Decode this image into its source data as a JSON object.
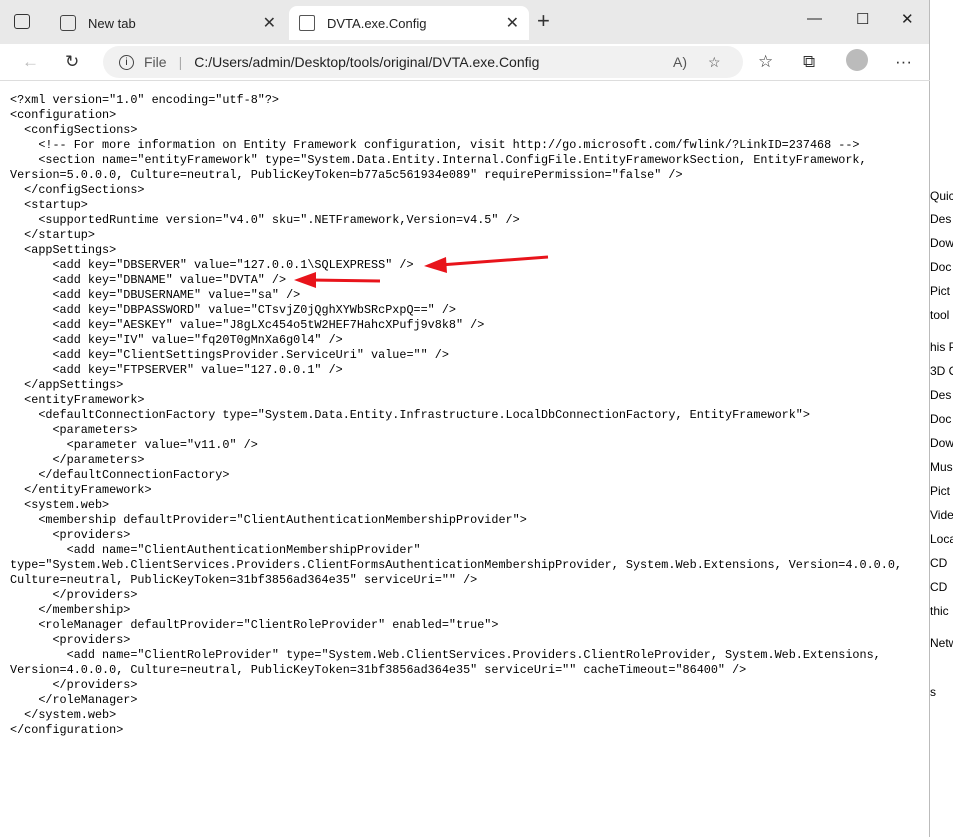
{
  "browser": {
    "tabs": [
      {
        "label": "New tab"
      },
      {
        "label": "DVTA.exe.Config"
      }
    ],
    "address": {
      "scheme": "File",
      "url": "C:/Users/admin/Desktop/tools/original/DVTA.exe.Config"
    }
  },
  "document": {
    "lines": [
      "<?xml version=\"1.0\" encoding=\"utf-8\"?>",
      "<configuration>",
      "  <configSections>",
      "    <!-- For more information on Entity Framework configuration, visit http://go.microsoft.com/fwlink/?LinkID=237468 -->",
      "    <section name=\"entityFramework\" type=\"System.Data.Entity.Internal.ConfigFile.EntityFrameworkSection, EntityFramework,",
      "Version=5.0.0.0, Culture=neutral, PublicKeyToken=b77a5c561934e089\" requirePermission=\"false\" />",
      "  </configSections>",
      "  <startup>",
      "    <supportedRuntime version=\"v4.0\" sku=\".NETFramework,Version=v4.5\" />",
      "  </startup>",
      "  <appSettings>",
      "      <add key=\"DBSERVER\" value=\"127.0.0.1\\SQLEXPRESS\" />",
      "      <add key=\"DBNAME\" value=\"DVTA\" />",
      "      <add key=\"DBUSERNAME\" value=\"sa\" />",
      "      <add key=\"DBPASSWORD\" value=\"CTsvjZ0jQghXYWbSRcPxpQ==\" />",
      "      <add key=\"AESKEY\" value=\"J8gLXc454o5tW2HEF7HahcXPufj9v8k8\" />",
      "      <add key=\"IV\" value=\"fq20T0gMnXa6g0l4\" />",
      "      <add key=\"ClientSettingsProvider.ServiceUri\" value=\"\" />",
      "      <add key=\"FTPSERVER\" value=\"127.0.0.1\" />",
      "  </appSettings>",
      "  <entityFramework>",
      "    <defaultConnectionFactory type=\"System.Data.Entity.Infrastructure.LocalDbConnectionFactory, EntityFramework\">",
      "      <parameters>",
      "        <parameter value=\"v11.0\" />",
      "      </parameters>",
      "    </defaultConnectionFactory>",
      "  </entityFramework>",
      "  <system.web>",
      "    <membership defaultProvider=\"ClientAuthenticationMembershipProvider\">",
      "      <providers>",
      "        <add name=\"ClientAuthenticationMembershipProvider\"",
      "type=\"System.Web.ClientServices.Providers.ClientFormsAuthenticationMembershipProvider, System.Web.Extensions, Version=4.0.0.0,",
      "Culture=neutral, PublicKeyToken=31bf3856ad364e35\" serviceUri=\"\" />",
      "      </providers>",
      "    </membership>",
      "    <roleManager defaultProvider=\"ClientRoleProvider\" enabled=\"true\">",
      "      <providers>",
      "        <add name=\"ClientRoleProvider\" type=\"System.Web.ClientServices.Providers.ClientRoleProvider, System.Web.Extensions,",
      "Version=4.0.0.0, Culture=neutral, PublicKeyToken=31bf3856ad364e35\" serviceUri=\"\" cacheTimeout=\"86400\" />",
      "      </providers>",
      "    </roleManager>",
      "  </system.web>",
      "</configuration>"
    ]
  },
  "annotation_color": "#e8141b",
  "background_window": {
    "items": [
      "Quick",
      "Des",
      "Dow",
      "Doc",
      "Pict",
      "tool",
      "his P",
      "3D O",
      "Des",
      "Doc",
      "Dow",
      "Mus",
      "Pict",
      "Vide",
      "Loca",
      "CD",
      "CD",
      "thic",
      "Netw",
      "s"
    ]
  }
}
